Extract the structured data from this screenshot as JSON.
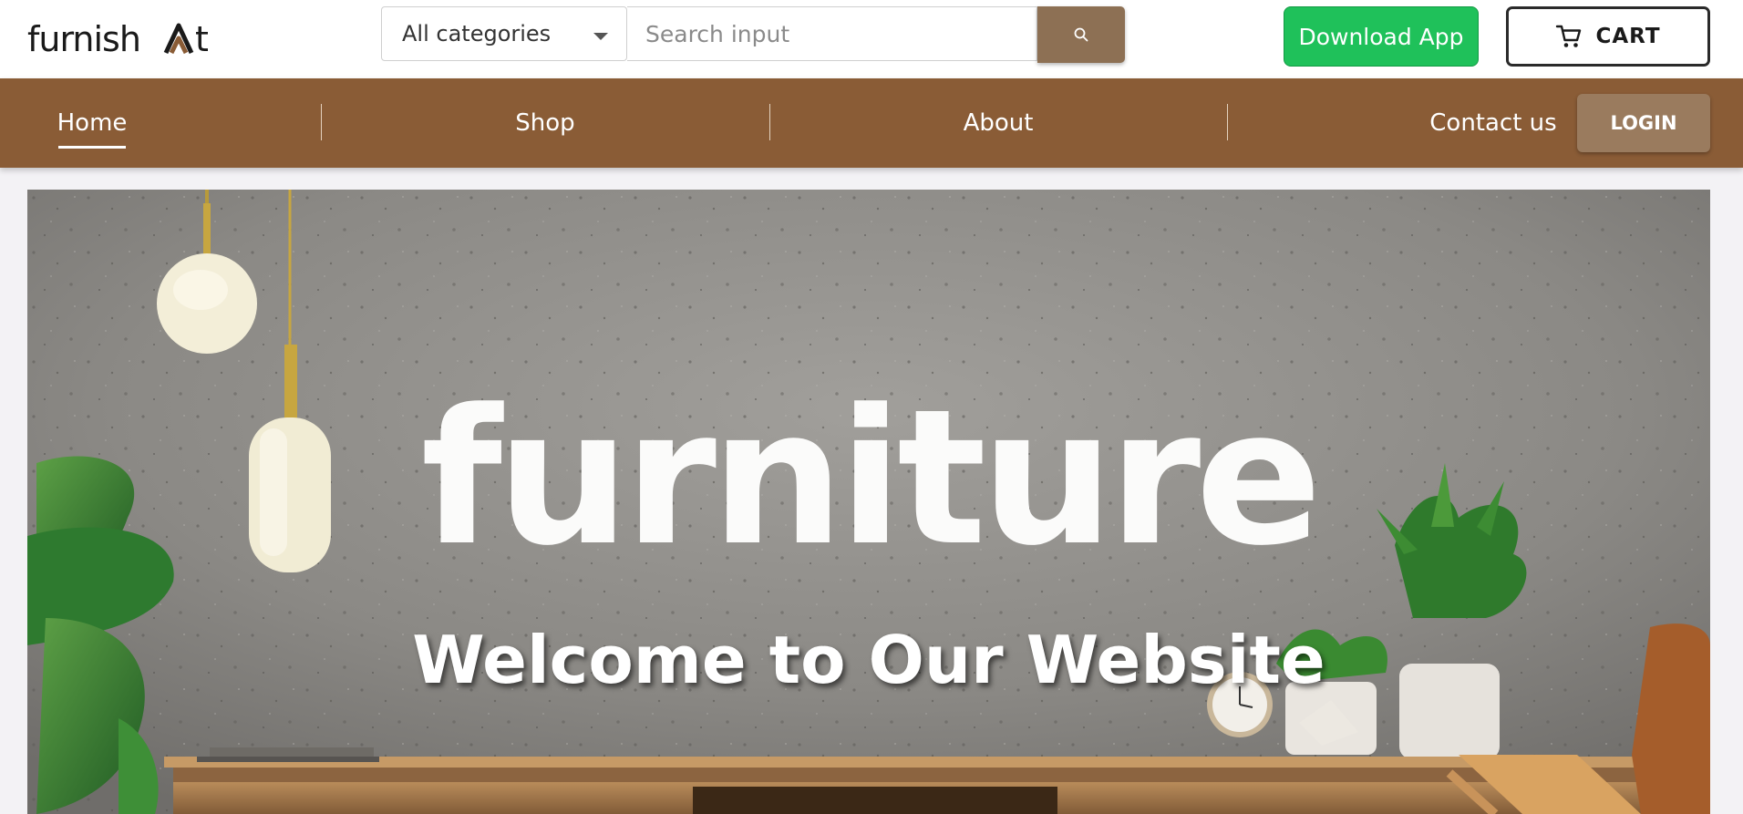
{
  "brand": {
    "name": "furnishart"
  },
  "header": {
    "category_select": {
      "selected": "All categories"
    },
    "search": {
      "placeholder": "Search input"
    },
    "download_label": "Download App",
    "cart_label": "CART"
  },
  "nav": {
    "items": [
      {
        "label": "Home",
        "active": true
      },
      {
        "label": "Shop"
      },
      {
        "label": "About"
      },
      {
        "label": "Contact us"
      }
    ],
    "login_label": "LOGIN"
  },
  "hero": {
    "headline": "furniture",
    "welcome": "Welcome to Our Website"
  },
  "colors": {
    "nav_bg": "#8a5c36",
    "search_button": "#8d7054",
    "download_button": "#1fc15a",
    "login_button": "#9a7b5e",
    "page_bg": "#f3f2f5"
  },
  "icons": {
    "search": "search-icon",
    "cart": "cart-icon",
    "dropdown": "chevron-down-icon"
  }
}
